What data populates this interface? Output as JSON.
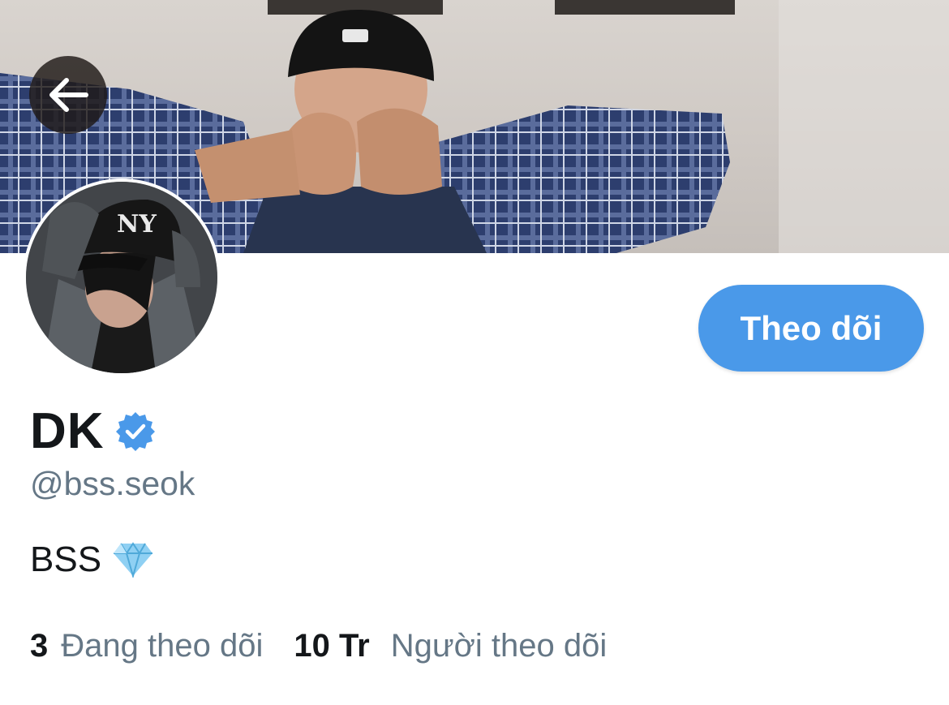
{
  "header": {
    "back_icon": "arrow-left-icon"
  },
  "profile": {
    "name": "DK",
    "verified_icon": "verified-badge-icon",
    "verified_color": "#4a99e9",
    "handle": "@bss.seok",
    "bio_text": "BSS",
    "bio_emoji_icon": "gem-icon"
  },
  "actions": {
    "follow_label": "Theo dõi",
    "follow_color": "#4a99e9"
  },
  "stats": {
    "following_count": "3",
    "following_label": "Đang theo dõi",
    "followers_count": "10 Tr",
    "followers_label": "Người theo dõi"
  }
}
